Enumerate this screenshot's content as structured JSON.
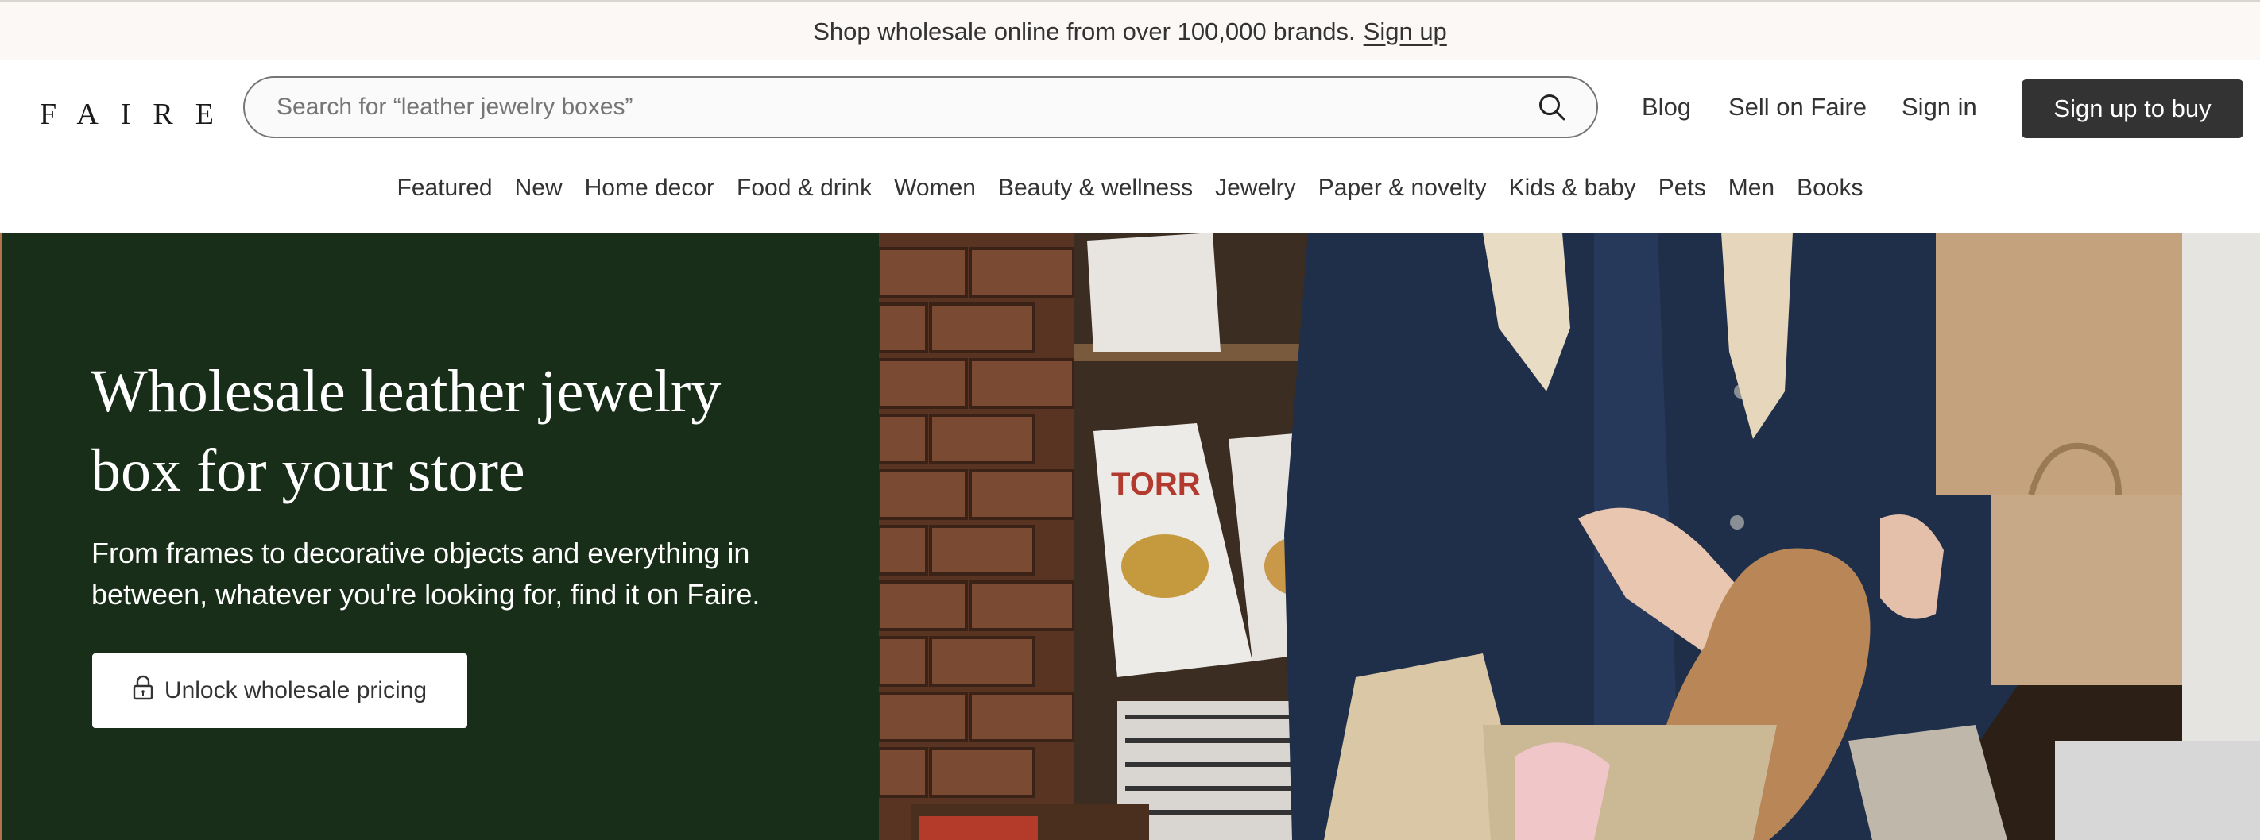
{
  "announcement": {
    "text": "Shop wholesale online from over 100,000 brands.",
    "link": "Sign up"
  },
  "header": {
    "logo": "FAIRE",
    "search_placeholder": "Search for “leather jewelry boxes”",
    "nav": {
      "blog": "Blog",
      "sell": "Sell on Faire",
      "signin": "Sign in",
      "signup": "Sign up to buy"
    },
    "categories": [
      "Featured",
      "New",
      "Home decor",
      "Food & drink",
      "Women",
      "Beauty & wellness",
      "Jewelry",
      "Paper & novelty",
      "Kids & baby",
      "Pets",
      "Men",
      "Books"
    ]
  },
  "hero": {
    "title": "Wholesale leather jewelry box for your store",
    "subtitle": "From frames to decorative objects and everything in between, whatever you're looking for, find it on Faire.",
    "cta": "Unlock wholesale pricing",
    "photo_label": "TORR"
  },
  "colors": {
    "hero_bg": "#182e19",
    "button_dark": "#333333",
    "announce_bg": "#fbf8f6"
  },
  "icons": {
    "search": "search-icon",
    "lock": "lock-icon"
  }
}
